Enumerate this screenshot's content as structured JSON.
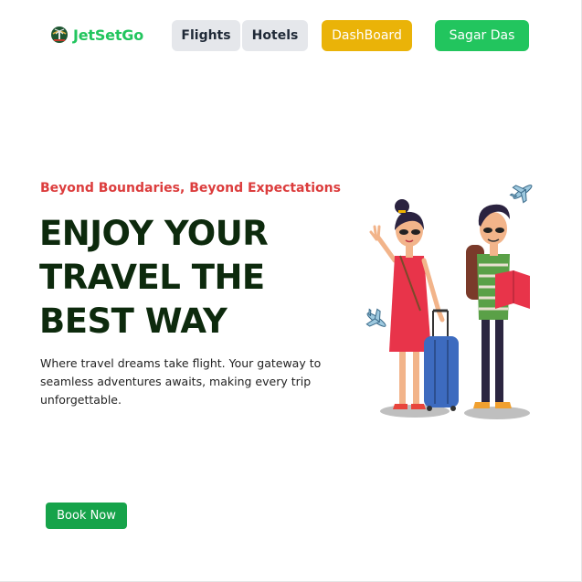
{
  "brand": {
    "name": "JetSetGo",
    "color": "#22c55e",
    "icon": "globe-palm-icon"
  },
  "nav": {
    "flights_label": "Flights",
    "hotels_label": "Hotels",
    "dashboard_label": "DashBoard",
    "user_label": "Sagar Das"
  },
  "hero": {
    "tagline": "Beyond Boundaries, Beyond Expectations",
    "headline_lines": [
      "ENJOY YOUR",
      "TRAVEL THE",
      "BEST WAY"
    ],
    "description": "Where travel dreams take flight. Your gateway to seamless adventures awaits, making every trip unforgettable.",
    "cta_label": "Book Now"
  },
  "colors": {
    "accent_green": "#22c55e",
    "dashboard_yellow": "#eab308",
    "tagline_red": "#dc3d3d",
    "headline_dark": "#0d2a0d",
    "cta_green": "#16a34a"
  },
  "illustration": {
    "icon": "travelers-illustration-icon"
  }
}
